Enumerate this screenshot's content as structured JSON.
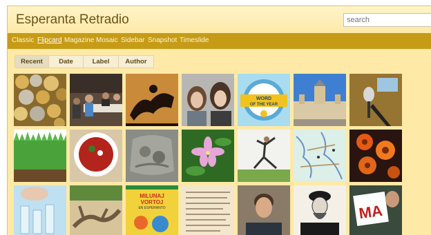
{
  "header": {
    "title": "Esperanta Retradio",
    "search_placeholder": "search"
  },
  "nav": {
    "items": [
      {
        "label": "Classic",
        "active": false
      },
      {
        "label": "Flipcard",
        "active": true
      },
      {
        "label": "Magazine",
        "active": false
      },
      {
        "label": "Mosaic",
        "active": false
      },
      {
        "label": "Sidebar",
        "active": false
      },
      {
        "label": "Snapshot",
        "active": false
      },
      {
        "label": "Timeslide",
        "active": false
      }
    ]
  },
  "filters": {
    "items": [
      {
        "label": "Recent",
        "active": true
      },
      {
        "label": "Date",
        "active": false
      },
      {
        "label": "Label",
        "active": false
      },
      {
        "label": "Author",
        "active": false
      }
    ]
  },
  "tiles": [
    {
      "name": "coins"
    },
    {
      "name": "office-meeting"
    },
    {
      "name": "greek-vase"
    },
    {
      "name": "two-women"
    },
    {
      "name": "word-of-the-year"
    },
    {
      "name": "palace"
    },
    {
      "name": "microphone"
    },
    {
      "name": "grass"
    },
    {
      "name": "borscht"
    },
    {
      "name": "stone-relief"
    },
    {
      "name": "pink-flower"
    },
    {
      "name": "yoga"
    },
    {
      "name": "map"
    },
    {
      "name": "orange-flowers"
    },
    {
      "name": "laboratory"
    },
    {
      "name": "driftwood"
    },
    {
      "name": "book-cover"
    },
    {
      "name": "manuscript"
    },
    {
      "name": "young-man"
    },
    {
      "name": "portrait-engraving"
    },
    {
      "name": "ma-sign"
    }
  ],
  "word_badge": {
    "line1": "WORD",
    "line2": "OF THE YEAR"
  },
  "book_cover": {
    "line1": "MILUNAJ",
    "line2": "VORTOJ",
    "line3": "EN ESPERANTO"
  },
  "sign": {
    "text": "MA"
  }
}
